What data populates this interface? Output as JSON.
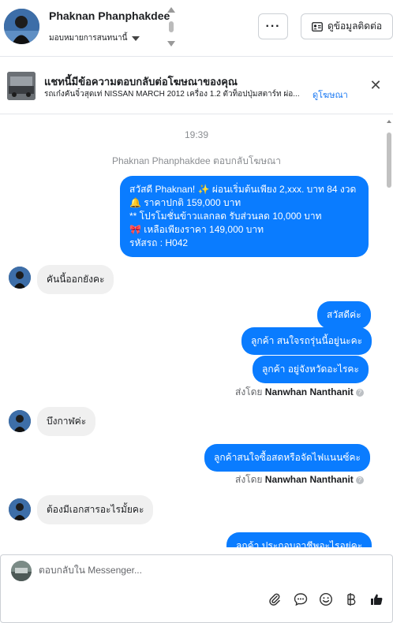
{
  "header": {
    "contact_name": "Phaknan Phanphakdee",
    "assign_label": "มอบหมายการสนทนานี้",
    "more_label": "···",
    "contact_info_label": "ดูข้อมูลติดต่อ"
  },
  "ad": {
    "title": "แชทนี้มีข้อความตอบกลับต่อโฆษณาของคุณ",
    "description": "รถเก๋งคันจิ๋วสุดเท่ NISSAN MARCH 2012 เครื่อง 1.2 ตัวท็อปปุ่มสตาร์ท ผ่อ...",
    "link_label": "ดูโฆษณา"
  },
  "chat": {
    "timestamp": "19:39",
    "reply_note": "Phaknan Phanphakdee ตอบกลับโฆษณา",
    "promo_lines": [
      "สวัสดี Phaknan! ✨  ผ่อนเริ่มต้นเพียง 2,xxx. บาท 84 งวด",
      "🔔 ราคาปกติ  159,000 บาท",
      "** โปรโมชั่นข้าวแลกลด รับส่วนลด 10,000 บาท",
      "🎀  เหลือเพียงราคา 149,000 บาท",
      " รหัสรถ : H042"
    ],
    "in_1": "คันนี้ออกยังคะ",
    "out_1": "สวัสดีค่ะ",
    "out_2": "ลูกค้า  สนใจรถรุ่นนี้อยู่นะคะ",
    "out_3": "ลูกค้า  อยู่จังหวัดอะไรคะ",
    "sent_by_prefix": "ส่งโดย ",
    "sender_name": "Nanwhan Nanthanit",
    "info_glyph": "?",
    "in_2": "บึงกาฬค่ะ",
    "out_4": "ลูกค้าสนใจซื้อสดหรือจัดไฟแนนซ์คะ",
    "in_3": "ต้องมีเอกสารอะไรมั้ยคะ",
    "out_5": "ลูกค้า ประกอบอาชีพอะไรอยู่คะ"
  },
  "composer": {
    "placeholder": "ตอบกลับใน Messenger..."
  },
  "icons": {
    "attach": "paperclip-icon",
    "saved_reply": "chat-bubble-icon",
    "emoji": "smiley-icon",
    "payment": "baht-icon",
    "like": "thumbs-up-icon"
  },
  "colors": {
    "outgoing": "#0a7cff",
    "incoming": "#f0f0f0",
    "link": "#1877f2"
  }
}
